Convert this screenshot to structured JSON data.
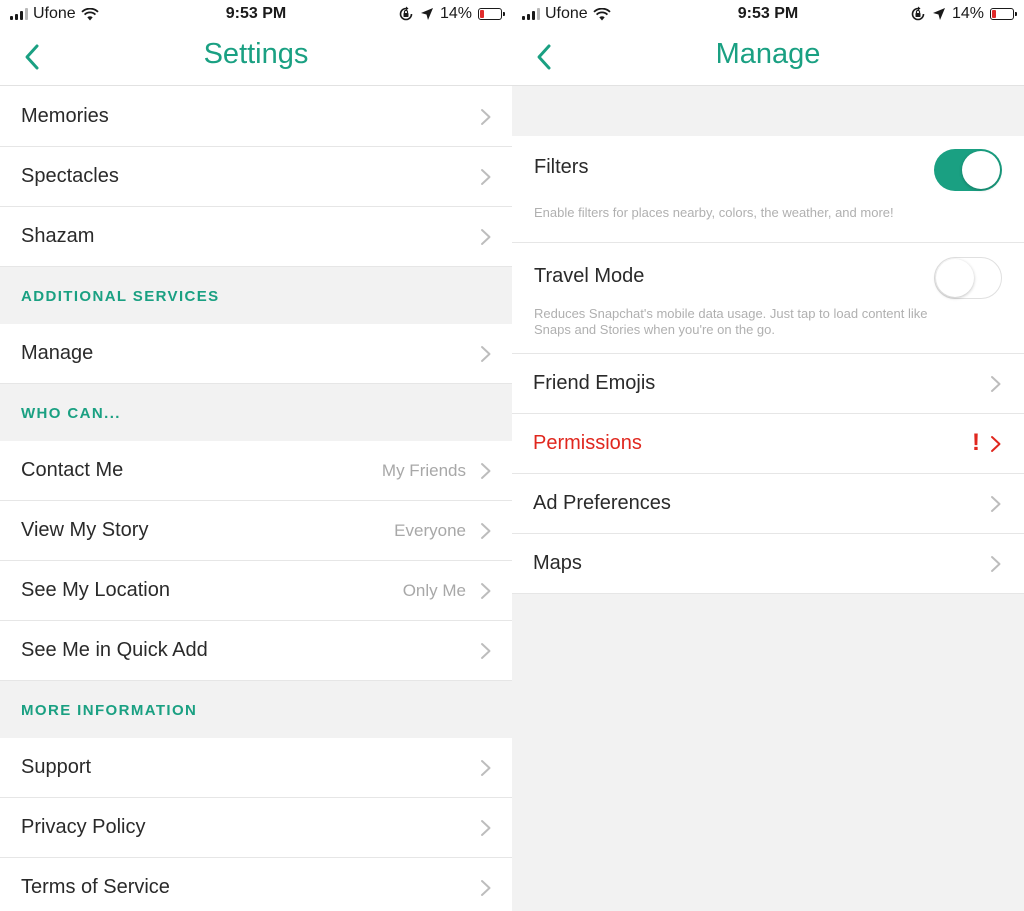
{
  "status_bar": {
    "carrier": "Ufone",
    "time": "9:53 PM",
    "battery": "14%"
  },
  "settings": {
    "title": "Settings",
    "items": [
      {
        "kind": "row",
        "label": "Memories",
        "value": ""
      },
      {
        "kind": "row",
        "label": "Spectacles",
        "value": ""
      },
      {
        "kind": "row",
        "label": "Shazam",
        "value": ""
      },
      {
        "kind": "section",
        "label": "ADDITIONAL SERVICES"
      },
      {
        "kind": "row",
        "label": "Manage",
        "value": ""
      },
      {
        "kind": "section",
        "label": "WHO CAN..."
      },
      {
        "kind": "row",
        "label": "Contact Me",
        "value": "My Friends"
      },
      {
        "kind": "row",
        "label": "View My Story",
        "value": "Everyone"
      },
      {
        "kind": "row",
        "label": "See My Location",
        "value": "Only Me"
      },
      {
        "kind": "row",
        "label": "See Me in Quick Add",
        "value": ""
      },
      {
        "kind": "section",
        "label": "MORE INFORMATION"
      },
      {
        "kind": "row",
        "label": "Support",
        "value": ""
      },
      {
        "kind": "row",
        "label": "Privacy Policy",
        "value": ""
      },
      {
        "kind": "row",
        "label": "Terms of Service",
        "value": ""
      }
    ]
  },
  "manage": {
    "title": "Manage",
    "filters": {
      "label": "Filters",
      "description": "Enable filters for places nearby, colors, the weather, and more!",
      "enabled": true
    },
    "travel_mode": {
      "label": "Travel Mode",
      "description": "Reduces Snapchat's mobile data usage. Just tap to load content like Snaps and Stories when you're on the go.",
      "enabled": false
    },
    "items": [
      {
        "label": "Friend Emojis",
        "alert": false
      },
      {
        "label": "Permissions",
        "alert": true,
        "alert_mark": "!"
      },
      {
        "label": "Ad Preferences",
        "alert": false
      },
      {
        "label": "Maps",
        "alert": false
      }
    ]
  },
  "colors": {
    "accent": "#1aa082",
    "alert": "#e0271e",
    "battery_low": "#e02b2b"
  },
  "icons": {
    "back": "chevron-left-icon",
    "disclosure": "chevron-right-icon",
    "wifi": "wifi-icon",
    "lock_rotation": "orientation-lock-icon",
    "location": "location-arrow-icon",
    "battery": "battery-icon",
    "signal": "signal-bars-icon"
  }
}
